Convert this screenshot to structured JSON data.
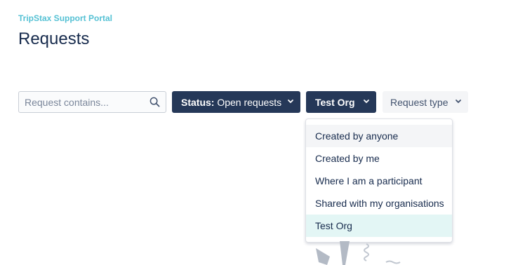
{
  "header": {
    "breadcrumb": "TripStax Support Portal",
    "title": "Requests"
  },
  "search": {
    "placeholder": "Request contains..."
  },
  "filters": {
    "status": {
      "prefix": "Status:",
      "value": "Open requests"
    },
    "organisation": {
      "value": "Test Org"
    },
    "request_type": {
      "value": "Request type"
    }
  },
  "dropdown": {
    "items": [
      {
        "label": "Created by anyone"
      },
      {
        "label": "Created by me"
      },
      {
        "label": "Where I am a participant"
      },
      {
        "label": "Shared with my organisations"
      },
      {
        "label": "Test Org"
      }
    ]
  },
  "icons": {
    "search": "search-icon",
    "chevron": "chevron-down-icon"
  },
  "colors": {
    "brand": "#55c1d4",
    "dark_button": "#253858",
    "selected_item": "#e3f6f5"
  }
}
